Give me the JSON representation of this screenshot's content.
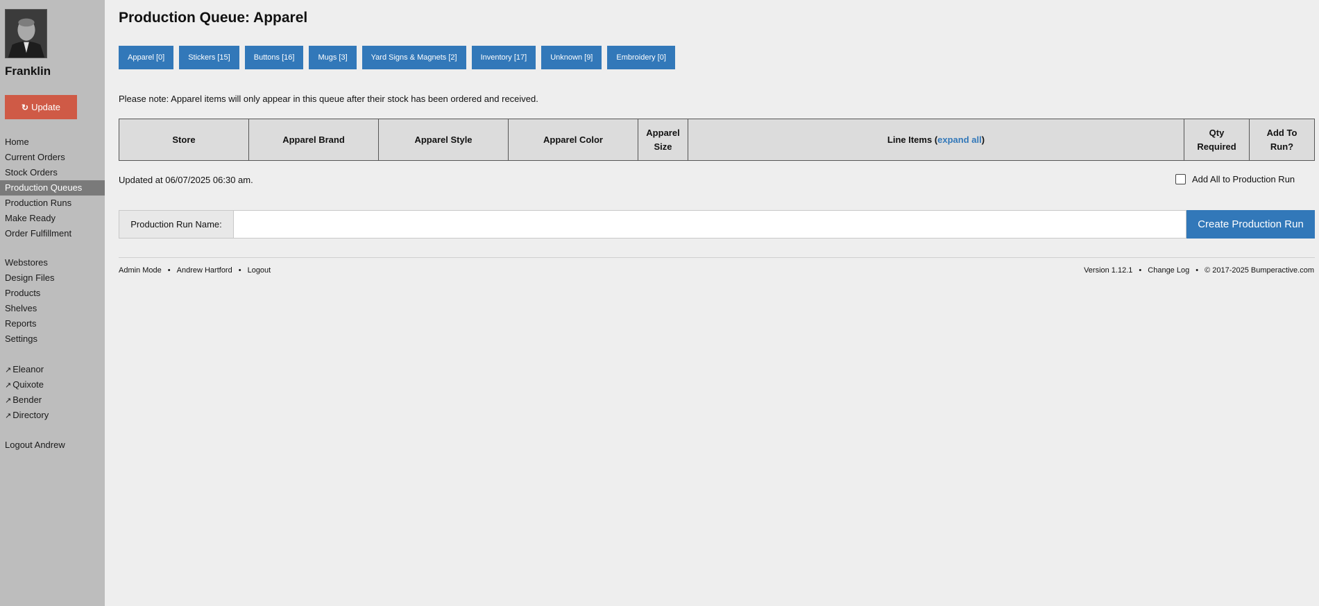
{
  "sidebar": {
    "user_name": "Franklin",
    "update_label": "Update",
    "nav_primary": [
      {
        "label": "Home"
      },
      {
        "label": "Current Orders"
      },
      {
        "label": "Stock Orders"
      },
      {
        "label": "Production Queues",
        "active": true
      },
      {
        "label": "Production Runs"
      },
      {
        "label": "Make Ready"
      },
      {
        "label": "Order Fulfillment"
      }
    ],
    "nav_secondary": [
      {
        "label": "Webstores"
      },
      {
        "label": "Design Files"
      },
      {
        "label": "Products"
      },
      {
        "label": "Shelves"
      },
      {
        "label": "Reports"
      },
      {
        "label": "Settings"
      }
    ],
    "nav_external": [
      {
        "label": "Eleanor"
      },
      {
        "label": "Quixote"
      },
      {
        "label": "Bender"
      },
      {
        "label": "Directory"
      }
    ],
    "logout_label": "Logout Andrew"
  },
  "page": {
    "title": "Production Queue: Apparel",
    "tabs": [
      {
        "label": "Apparel [0]"
      },
      {
        "label": "Stickers [15]"
      },
      {
        "label": "Buttons [16]"
      },
      {
        "label": "Mugs [3]"
      },
      {
        "label": "Yard Signs & Magnets [2]"
      },
      {
        "label": "Inventory [17]"
      },
      {
        "label": "Unknown [9]"
      },
      {
        "label": "Embroidery [0]"
      }
    ],
    "note": "Please note: Apparel items will only appear in this queue after their stock has been ordered and received."
  },
  "table": {
    "columns": {
      "store": "Store",
      "brand": "Apparel Brand",
      "style": "Apparel Style",
      "color": "Apparel Color",
      "size_line1": "Apparel",
      "size_line2": "Size",
      "line_items_prefix": "Line Items (",
      "expand_all": "expand all",
      "line_items_suffix": ")",
      "qty_line1": "Qty",
      "qty_line2": "Required",
      "add_line1": "Add To",
      "add_line2": "Run?"
    }
  },
  "status": {
    "updated": "Updated at 06/07/2025 06:30 am.",
    "add_all_label": "Add All to Production Run"
  },
  "run_form": {
    "label": "Production Run Name:",
    "value": "",
    "button": "Create Production Run"
  },
  "footer": {
    "admin_mode": "Admin Mode",
    "user": "Andrew Hartford",
    "logout": "Logout",
    "version": "Version 1.12.1",
    "change_log": "Change Log",
    "copyright": "© 2017-2025 Bumperactive.com",
    "separator": "•"
  },
  "colors": {
    "accent": "#3278b9",
    "update": "#cf5a46",
    "sidebar": "#bdbdbd",
    "active_nav": "#7a7a7a"
  }
}
